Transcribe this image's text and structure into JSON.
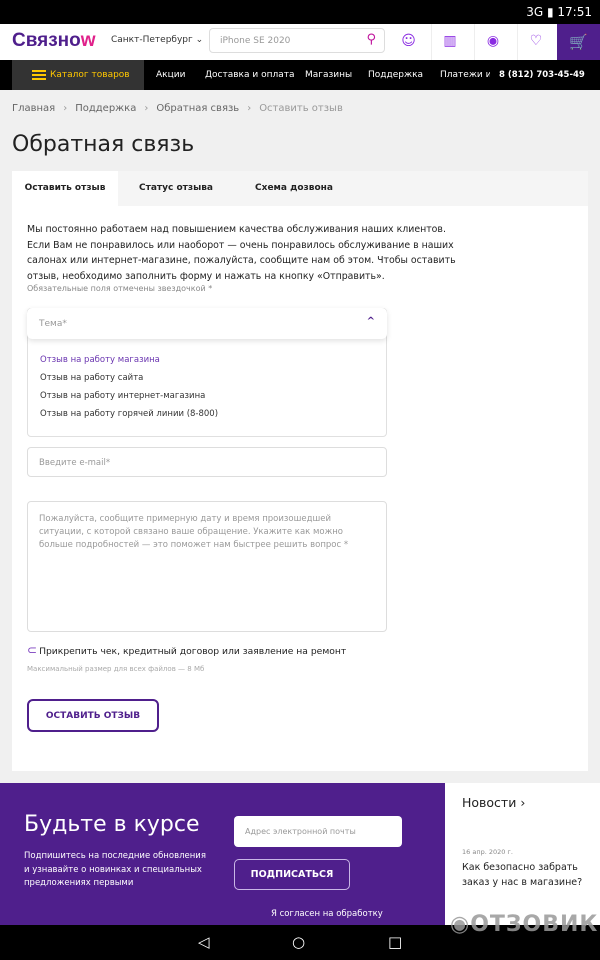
{
  "status_bar": {
    "network": "3G",
    "time": "17:51"
  },
  "header": {
    "logo": "Связной",
    "city": "Санкт-Петербург",
    "search_placeholder": "iPhone SE 2020",
    "brand_color": "#4f1f8c",
    "accent_color": "#ffc700"
  },
  "nav": {
    "catalog": "Каталог товаров",
    "items": [
      "Акции",
      "Доставка и оплата",
      "Магазины",
      "Поддержка",
      "Платежи и"
    ],
    "phone": "8 (812) 703-45-49"
  },
  "breadcrumb": [
    "Главная",
    "Поддержка",
    "Обратная связь",
    "Оставить отзыв"
  ],
  "page_title": "Обратная связь",
  "tabs": [
    "Оставить отзыв",
    "Статус отзыва",
    "Схема дозвона"
  ],
  "form": {
    "intro": "Мы постоянно работаем над повышением качества обслуживания наших клиентов. Если Вам не понравилось или наоборот — очень понравилось обслуживание в наших салонах или интернет-магазине, пожалуйста, сообщите нам об этом. Чтобы оставить отзыв, необходимо заполнить форму и нажать на кнопку «Отправить».",
    "required_note": "Обязательные поля отмечены звездочкой *",
    "topic_placeholder": "Тема*",
    "topic_options": [
      "Отзыв на работу магазина",
      "Отзыв на работу сайта",
      "Отзыв на работу интернет-магазина",
      "Отзыв на работу горячей линии (8-800)"
    ],
    "email_placeholder": "Введите e-mail*",
    "message_placeholder": "Пожалуйста, сообщите примерную дату и время произошедшей ситуации, с которой связано ваше обращение. Укажите как можно больше подробностей — это поможет нам быстрее решить вопрос *",
    "attach_label": "Прикрепить чек, кредитный договор или заявление на ремонт",
    "max_size": "Максимальный размер для всех файлов — 8 Мб",
    "submit": "ОСТАВИТЬ ОТЗЫВ"
  },
  "footer": {
    "title": "Будьте в курсе",
    "desc": "Подпишитесь на последние обновления и узнавайте о новинках и специальных предложениях первыми",
    "email_placeholder": "Адрес электронной почты",
    "subscribe": "ПОДПИСАТЬСЯ",
    "agree": "Я согласен на обработку"
  },
  "news": {
    "title": "Новости ›",
    "date": "16 апр. 2020 г.",
    "headline": "Как безопасно забрать заказ у нас в магазине?"
  },
  "watermark": "ОТЗОВИК"
}
